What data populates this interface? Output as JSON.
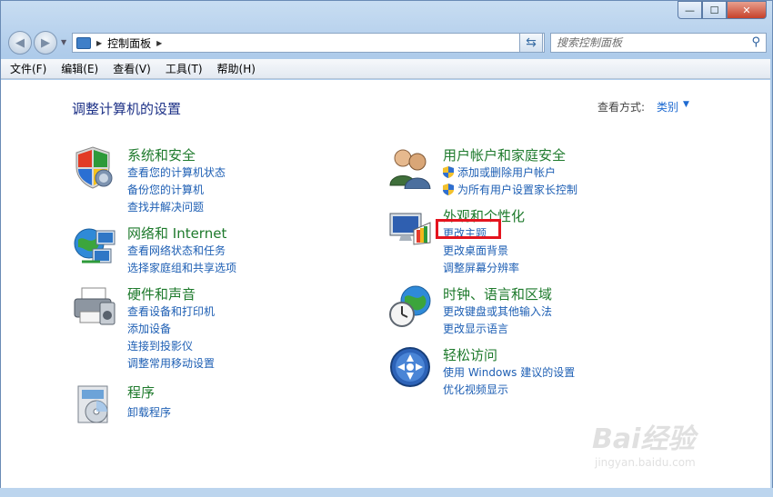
{
  "window": {
    "minimize_glyph": "—",
    "maximize_glyph": "☐",
    "close_glyph": "✕"
  },
  "address": {
    "crumb": "控制面板",
    "search_placeholder": "搜索控制面板"
  },
  "menu": [
    "文件(F)",
    "编辑(E)",
    "查看(V)",
    "工具(T)",
    "帮助(H)"
  ],
  "page": {
    "title": "调整计算机的设置",
    "view_by_label": "查看方式:",
    "view_by_value": "类别"
  },
  "categories": {
    "system": {
      "title": "系统和安全",
      "links": [
        "查看您的计算机状态",
        "备份您的计算机",
        "查找并解决问题"
      ]
    },
    "network": {
      "title": "网络和 Internet",
      "links": [
        "查看网络状态和任务",
        "选择家庭组和共享选项"
      ]
    },
    "hardware": {
      "title": "硬件和声音",
      "links": [
        "查看设备和打印机",
        "添加设备",
        "连接到投影仪",
        "调整常用移动设置"
      ]
    },
    "programs": {
      "title": "程序",
      "links": [
        "卸载程序"
      ]
    },
    "users": {
      "title": "用户帐户和家庭安全",
      "links": [
        "添加或删除用户帐户",
        "为所有用户设置家长控制"
      ]
    },
    "appearance": {
      "title": "外观和个性化",
      "links": [
        "更改主题",
        "更改桌面背景",
        "调整屏幕分辨率"
      ]
    },
    "clock": {
      "title": "时钟、语言和区域",
      "links": [
        "更改键盘或其他输入法",
        "更改显示语言"
      ]
    },
    "ease": {
      "title": "轻松访问",
      "links": [
        "使用 Windows 建议的设置",
        "优化视频显示"
      ]
    }
  },
  "watermark": {
    "brand": "Bai经验",
    "url": "jingyan.baidu.com"
  },
  "colors": {
    "category_title": "#1e7a2c",
    "link": "#1e5fb4",
    "page_title": "#1e3287",
    "highlight": "#e4141e"
  }
}
